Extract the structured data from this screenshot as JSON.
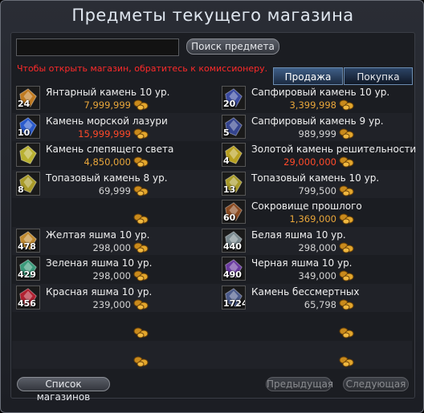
{
  "window": {
    "title": "Предметы текущего магазина"
  },
  "search": {
    "value": "",
    "button_label": "Поиск предмета"
  },
  "notice": "Чтобы открыть магазин, обратитесь к комиссионеру.",
  "tabs": [
    {
      "label": "Продажа",
      "active": true
    },
    {
      "label": "Покупка",
      "active": false
    }
  ],
  "left_items": [
    {
      "name": "Янтарный камень 10 ур.",
      "price": "7,999,999",
      "price_color": "gold",
      "qty": "24",
      "icon": "amber-stone-icon",
      "color": "#c07a20"
    },
    {
      "name": "Камень морской лазури",
      "price": "15,999,999",
      "price_color": "red",
      "qty": "10",
      "icon": "sea-azure-stone-icon",
      "color": "#2a5acc"
    },
    {
      "name": "Камень слепящего света",
      "price": "4,850,000",
      "price_color": "gold",
      "qty": "",
      "icon": "blinding-light-stone-icon",
      "color": "#b8b030"
    },
    {
      "name": "Топазовый камень 8 ур.",
      "price": "69,999",
      "price_color": "white",
      "qty": "8",
      "icon": "topaz-stone-icon",
      "color": "#a89a28"
    },
    null,
    {
      "name": "Желтая яшма 10 ур.",
      "price": "298,000",
      "price_color": "white",
      "qty": "478",
      "icon": "yellow-jasper-icon",
      "color": "#c08a30"
    },
    {
      "name": "Зеленая яшма 10 ур.",
      "price": "298,000",
      "price_color": "white",
      "qty": "429",
      "icon": "green-jasper-icon",
      "color": "#3a9a7a"
    },
    {
      "name": "Красная яшма 10 ур.",
      "price": "239,000",
      "price_color": "white",
      "qty": "456",
      "icon": "red-jasper-icon",
      "color": "#b02030"
    },
    null,
    null
  ],
  "right_items": [
    {
      "name": "Сапфировый камень 10 ур.",
      "price": "3,399,998",
      "price_color": "gold",
      "qty": "20",
      "icon": "sapphire-stone-icon",
      "color": "#3a4aa0"
    },
    {
      "name": "Сапфировый камень 9 ур.",
      "price": "989,999",
      "price_color": "white",
      "qty": "5",
      "icon": "sapphire-stone-9-icon",
      "color": "#34448e"
    },
    {
      "name": "Золотой камень решительности",
      "price": "29,000,000",
      "price_color": "red",
      "qty": "4",
      "icon": "golden-resolve-stone-icon",
      "color": "#b8a020"
    },
    {
      "name": "Топазовый камень 10 ур.",
      "price": "799,500",
      "price_color": "white",
      "qty": "13",
      "icon": "topaz-stone-10-icon",
      "color": "#a89a28"
    },
    {
      "name": "Сокровище прошлого",
      "price": "1,369,000",
      "price_color": "gold",
      "qty": "60",
      "icon": "treasure-chest-icon",
      "color": "#8a4a20"
    },
    {
      "name": "Белая яшма 10 ур.",
      "price": "298,000",
      "price_color": "white",
      "qty": "440",
      "icon": "white-jasper-icon",
      "color": "#7a8a90"
    },
    {
      "name": "Черная яшма 10 ур.",
      "price": "349,000",
      "price_color": "white",
      "qty": "490",
      "icon": "black-jasper-icon",
      "color": "#6a3aa0"
    },
    {
      "name": "Камень бессмертных",
      "price": "65,798",
      "price_color": "white",
      "qty": "1724",
      "icon": "immortals-stone-icon",
      "color": "#4a5a8a"
    },
    null,
    null
  ],
  "footer": {
    "shop_list_label": "Список магазинов",
    "prev_label": "Предыдущая",
    "next_label": "Следующая"
  }
}
